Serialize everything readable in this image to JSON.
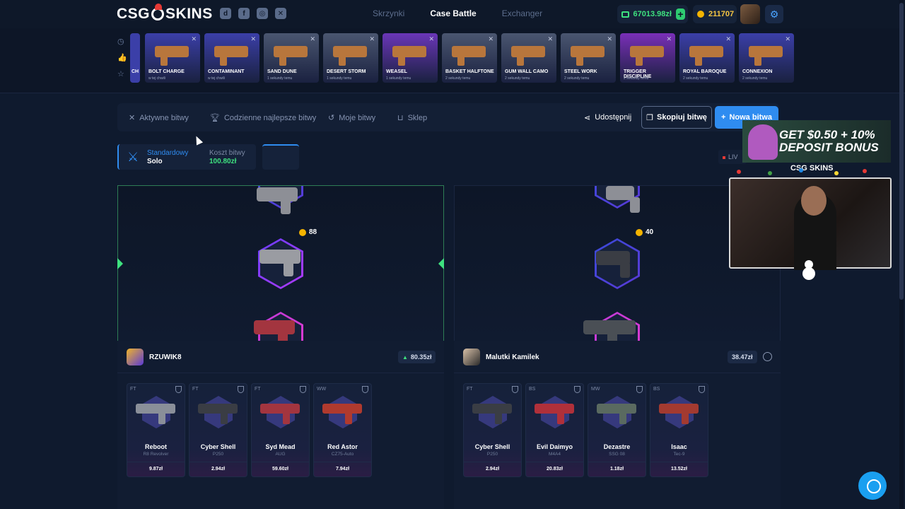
{
  "header": {
    "logo_left": "CSG",
    "logo_right": "SKINS",
    "social_icons": [
      "discord-icon",
      "facebook-icon",
      "instagram-icon",
      "x-icon"
    ],
    "nav": [
      "Skrzynki",
      "Case Battle",
      "Exchanger"
    ],
    "active_nav": "Case Battle",
    "balance": "67013.98zł",
    "coins": "211707"
  },
  "drops": {
    "left_icons": [
      "clock-icon",
      "thumbs-up-icon",
      "star-icon"
    ],
    "partial_name": "CH",
    "items": [
      {
        "name": "BOLT CHARGE",
        "time": "w tej chwili",
        "color": "#3b3fa8"
      },
      {
        "name": "CONTAMINANT",
        "time": "w tej chwili",
        "color": "#3b3fa8"
      },
      {
        "name": "SAND DUNE",
        "time": "1 sekundy temu",
        "color": "#4a5670"
      },
      {
        "name": "DESERT STORM",
        "time": "1 sekundy temu",
        "color": "#4a5670"
      },
      {
        "name": "WEASEL",
        "time": "1 sekundy temu",
        "color": "#6a36b8"
      },
      {
        "name": "BASKET HALFTONE",
        "time": "2 sekundy temu",
        "color": "#4a5670"
      },
      {
        "name": "GUM WALL CAMO",
        "time": "2 sekundy temu",
        "color": "#4a5670"
      },
      {
        "name": "STEEL WORK",
        "time": "2 sekundy temu",
        "color": "#4a5670"
      },
      {
        "name": "TRIGGER DISCIPLINE",
        "time": "2 sekundy temu",
        "color": "#7a2fb8"
      },
      {
        "name": "ROYAL BAROQUE",
        "time": "2 sekundy temu",
        "color": "#3b3fa8"
      },
      {
        "name": "CONNEXION",
        "time": "2 sekundy temu",
        "color": "#3b3fa8"
      }
    ]
  },
  "tabs": {
    "items": [
      "Aktywne bitwy",
      "Codzienne najlepsze bitwy",
      "Moje bitwy",
      "Sklep"
    ],
    "share": "Udostępnij",
    "copy": "Skopiuj bitwę",
    "new": "Nowa bitwa"
  },
  "battle": {
    "mode_label": "Standardowy",
    "mode_value": "Solo",
    "cost_label": "Koszt bitwy",
    "cost_value": "100.80zł",
    "live": "LIV"
  },
  "reels": {
    "left_coin": "88",
    "right_coin": "40"
  },
  "players": [
    {
      "name": "RZUWIK8",
      "total": "80.35zł",
      "items": [
        {
          "wear": "FT",
          "name": "Reboot",
          "type": "R8 Revolver",
          "price": "9.87zł",
          "color": "#8a8f99"
        },
        {
          "wear": "FT",
          "name": "Cyber Shell",
          "type": "P250",
          "price": "2.94zł",
          "color": "#3a3d44"
        },
        {
          "wear": "FT",
          "name": "Syd Mead",
          "type": "AUG",
          "price": "59.60zł",
          "color": "#a3353f"
        },
        {
          "wear": "WW",
          "name": "Red Astor",
          "type": "CZ75-Auto",
          "price": "7.94zł",
          "color": "#b03a2e"
        }
      ]
    },
    {
      "name": "Malutki Kamilek",
      "total": "38.47zł",
      "items": [
        {
          "wear": "FT",
          "name": "Cyber Shell",
          "type": "P250",
          "price": "2.94zł",
          "color": "#3a3d44"
        },
        {
          "wear": "BS",
          "name": "Evil Daimyo",
          "type": "M4A4",
          "price": "20.83zł",
          "color": "#b0303a"
        },
        {
          "wear": "MW",
          "name": "Dezastre",
          "type": "SSG 08",
          "price": "1.18zł",
          "color": "#5a6a60"
        },
        {
          "wear": "BS",
          "name": "Isaac",
          "type": "Tec-9",
          "price": "13.52zł",
          "color": "#a33a30"
        }
      ]
    }
  ],
  "promo": {
    "line1": "GET $0.50 + 10%",
    "line2": "DEPOSIT BONUS",
    "brand": "CSG SKINS"
  }
}
